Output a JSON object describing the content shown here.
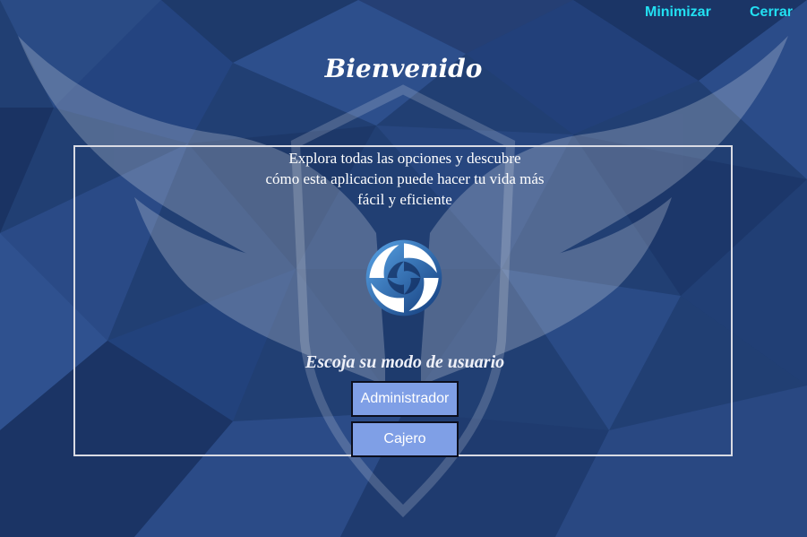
{
  "window": {
    "minimize_label": "Minimizar",
    "close_label": "Cerrar"
  },
  "welcome": {
    "title": "Bienvenido",
    "description_lines": [
      "Explora todas las opciones y descubre",
      "cómo esta aplicacion puede hacer tu vida más",
      "fácil y eficiente"
    ]
  },
  "mode_selection": {
    "label": "Escoja su modo de usuario",
    "admin_label": "Administrador",
    "cashier_label": "Cajero"
  },
  "icons": {
    "logo": "swirl-logo-icon",
    "background": "wings-shield-emblem"
  },
  "colors": {
    "background": "#1f3a6e",
    "top_link": "#22e0f2",
    "button_fill": "#7f9fe6",
    "button_border": "#0c0f1e",
    "panel_border": "#d9dbe4"
  }
}
